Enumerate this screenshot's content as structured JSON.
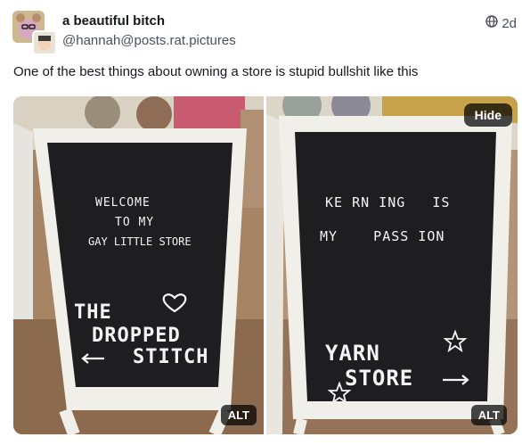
{
  "post": {
    "display_name": "a beautiful bitch",
    "handle": "@hannah@posts.rat.pictures",
    "timestamp": "2d",
    "visibility_icon": "globe-icon",
    "text": "One of the best things about owning a store is stupid bullshit like this"
  },
  "media": {
    "hide_label": "Hide",
    "left": {
      "alt_label": "ALT",
      "line1": "WELCOME",
      "line2": "TO MY",
      "line3": "GAY LITTLE STORE",
      "big1": "THE",
      "big2": "DROPPED",
      "big3": "STITCH"
    },
    "right": {
      "alt_label": "ALT",
      "line1": "KE RN ING   IS",
      "line2": "MY    PASS ION",
      "big1": "YARN",
      "big2": "STORE"
    }
  },
  "colors": {
    "board": "#1d1d1f",
    "frame": "#f2f0ec",
    "floor": "#8f6d52"
  }
}
